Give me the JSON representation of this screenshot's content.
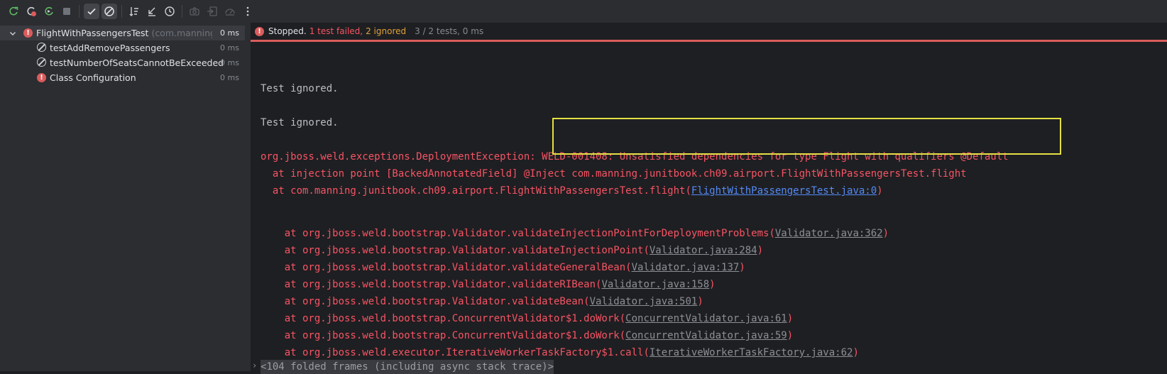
{
  "toolbar": {
    "icons": [
      "rerun-icon",
      "rerun-failed-icon",
      "toggle-auto-test-icon",
      "stop-icon",
      "show-passed-icon",
      "show-ignored-icon",
      "sort-alphabetically-icon",
      "sort-by-duration-icon",
      "history-icon",
      "camera-icon",
      "import-icon",
      "export-icon",
      "more-icon"
    ]
  },
  "tree": {
    "root": {
      "name": "FlightWithPassengersTest",
      "sub": "(com.manning.junit",
      "time": "0 ms"
    },
    "items": [
      {
        "name": "testAddRemovePassengers",
        "time": "0 ms",
        "status": "ignored"
      },
      {
        "name": "testNumberOfSeatsCannotBeExceeded",
        "time": "0 ms",
        "status": "ignored"
      },
      {
        "name": "Class Configuration",
        "time": "0 ms",
        "status": "failed"
      }
    ]
  },
  "status": {
    "stopped": "Stopped.",
    "failed": "1 test failed,",
    "ignored": "2 ignored",
    "summary": "3 / 2 tests, 0 ms"
  },
  "console": {
    "ignored1": "Test ignored.",
    "ignored2": "Test ignored.",
    "exception": "org.jboss.weld.exceptions.DeploymentException: WELD-001408: Unsatisfied dependencies for type Flight with qualifiers @Default",
    "at1": "  at injection point [BackedAnnotatedField] @Inject com.manning.junitbook.ch09.airport.FlightWithPassengersTest.flight",
    "at2_prefix": "  at com.manning.junitbook.ch09.airport.FlightWithPassengersTest.flight(",
    "at2_link": "FlightWithPassengersTest.java:0",
    "at2_suffix": ")",
    "frames": [
      {
        "prefix": "    at org.jboss.weld.bootstrap.Validator.validateInjectionPointForDeploymentProblems(",
        "link": "Validator.java:362"
      },
      {
        "prefix": "    at org.jboss.weld.bootstrap.Validator.validateInjectionPoint(",
        "link": "Validator.java:284"
      },
      {
        "prefix": "    at org.jboss.weld.bootstrap.Validator.validateGeneralBean(",
        "link": "Validator.java:137"
      },
      {
        "prefix": "    at org.jboss.weld.bootstrap.Validator.validateRIBean(",
        "link": "Validator.java:158"
      },
      {
        "prefix": "    at org.jboss.weld.bootstrap.Validator.validateBean(",
        "link": "Validator.java:501"
      },
      {
        "prefix": "    at org.jboss.weld.bootstrap.ConcurrentValidator$1.doWork(",
        "link": "ConcurrentValidator.java:61"
      },
      {
        "prefix": "    at org.jboss.weld.bootstrap.ConcurrentValidator$1.doWork(",
        "link": "ConcurrentValidator.java:59"
      },
      {
        "prefix": "    at org.jboss.weld.executor.IterativeWorkerTaskFactory$1.call(",
        "link": "IterativeWorkerTaskFactory.java:62"
      }
    ],
    "close_paren": ")",
    "folded": "<104 folded frames (including async stack trace)>"
  },
  "colors": {
    "error": "#f75464",
    "ignored": "#e0a03a",
    "highlight": "#e5e043"
  }
}
